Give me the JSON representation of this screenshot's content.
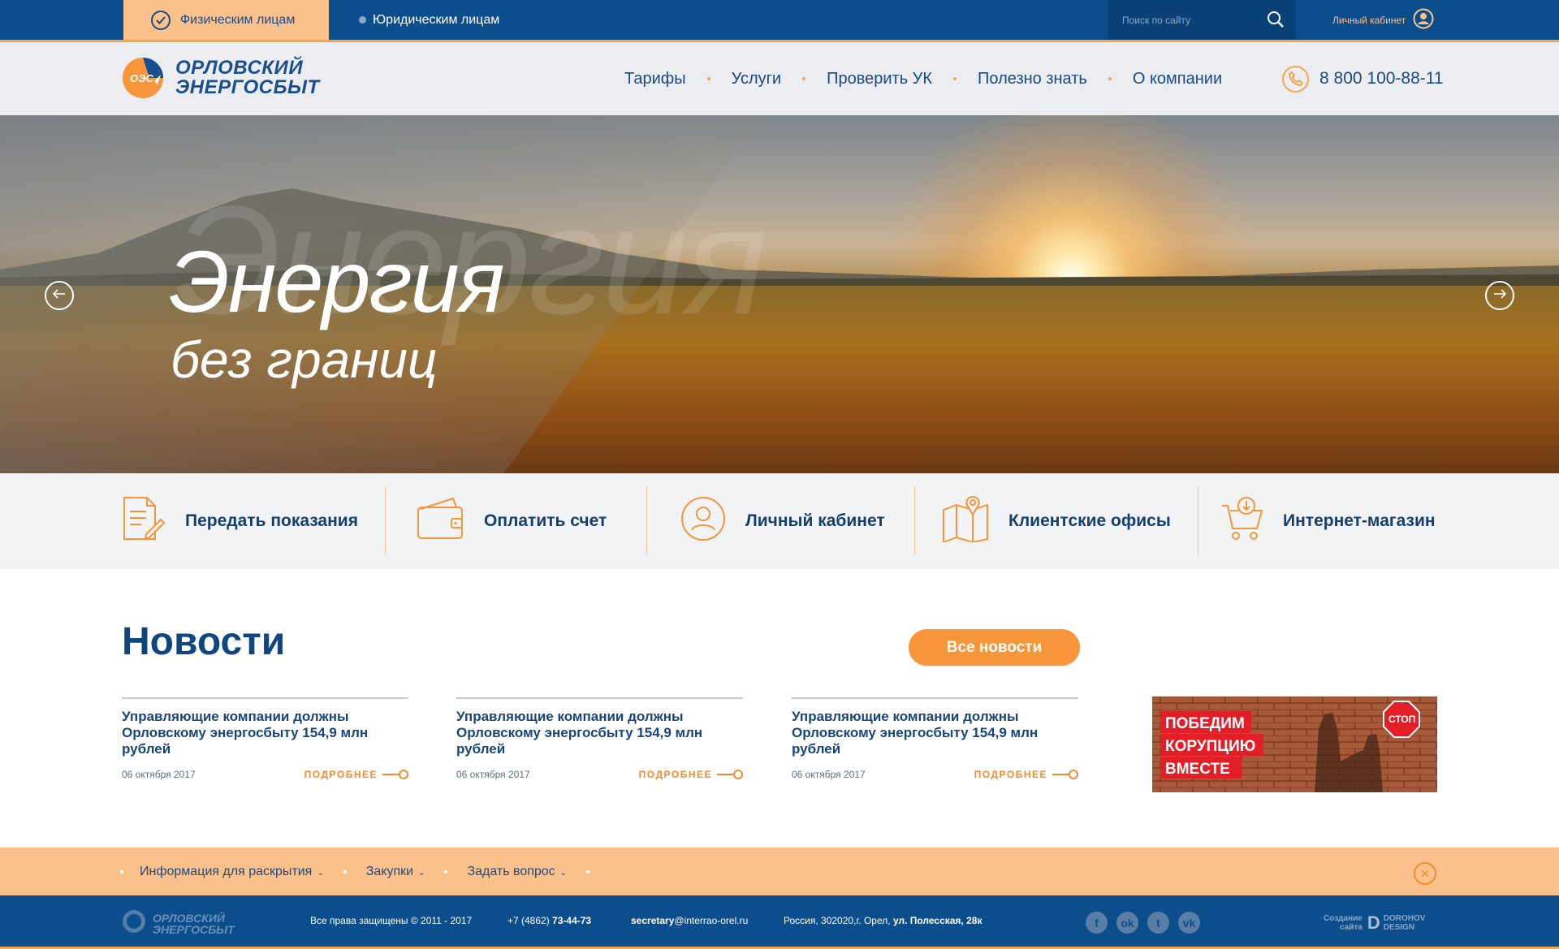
{
  "topbar": {
    "tab_physical": "Физическим лицам",
    "tab_legal": "Юридическим лицам",
    "search_placeholder": "Поиск по сайту",
    "cabinet": "Личный кабинет"
  },
  "header": {
    "logo_abbr": "ОЭС",
    "logo_line1": "ОРЛОВСКИЙ",
    "logo_line2": "ЭНЕРГОСБЫТ",
    "nav": [
      "Тарифы",
      "Услуги",
      "Проверить УК",
      "Полезно знать",
      "О компании"
    ],
    "phone": "8 800 100-88-11"
  },
  "hero": {
    "title": "Энергия",
    "subtitle": "без границ",
    "ghost": "Энергия"
  },
  "quick": [
    {
      "label": "Передать показания",
      "icon": "document-pen-icon"
    },
    {
      "label": "Оплатить счет",
      "icon": "wallet-icon"
    },
    {
      "label": "Личный кабинет",
      "icon": "user-icon"
    },
    {
      "label": "Клиентские офисы",
      "icon": "map-pin-icon"
    },
    {
      "label": "Интернет-магазин",
      "icon": "cart-icon"
    }
  ],
  "news": {
    "title": "Новости",
    "all_button": "Все новости",
    "items": [
      {
        "title": "Управляющие компании должны Орловскому энергосбыту 154,9 млн рублей",
        "date": "06 октября 2017",
        "more": "ПОДРОБНЕЕ"
      },
      {
        "title": "Управляющие компании должны Орловскому энергосбыту 154,9 млн рублей",
        "date": "06 октября 2017",
        "more": "ПОДРОБНЕЕ"
      },
      {
        "title": "Управляющие компании должны Орловскому энергосбыту 154,9 млн рублей",
        "date": "06 октября 2017",
        "more": "ПОДРОБНЕЕ"
      }
    ],
    "banner": {
      "line1": "ПОБЕДИМ",
      "line2": "КОРУПЦИЮ",
      "line3": "ВМЕСТЕ",
      "stop": "СТОП"
    }
  },
  "footer_menu": {
    "items": [
      "Информация для раскрытия",
      "Закупки",
      "Задать вопрос"
    ]
  },
  "footer": {
    "logo_line1": "ОРЛОВСКИЙ",
    "logo_line2": "ЭНЕРГОСБЫТ",
    "copyright": "Все права защищены © 2011 - 2017",
    "phone_prefix": "+7 (4862)",
    "phone_number": "73-44-73",
    "email_user": "secretary",
    "email_domain": "@interrao-orel.ru",
    "address_prefix": "Россия, 302020,г. Орел,",
    "address_street": "ул. Полесская, 28к",
    "social": [
      "facebook-icon",
      "odnoklassniki-icon",
      "twitter-icon",
      "vk-icon"
    ],
    "credits_line1": "Создание",
    "credits_line2": "сайта",
    "studio_line1": "DOROHOV",
    "studio_line2": "DESIGN"
  },
  "colors": {
    "primary_blue": "#0c4d8c",
    "accent_orange": "#f6953a",
    "light_orange": "#fbc18d"
  }
}
